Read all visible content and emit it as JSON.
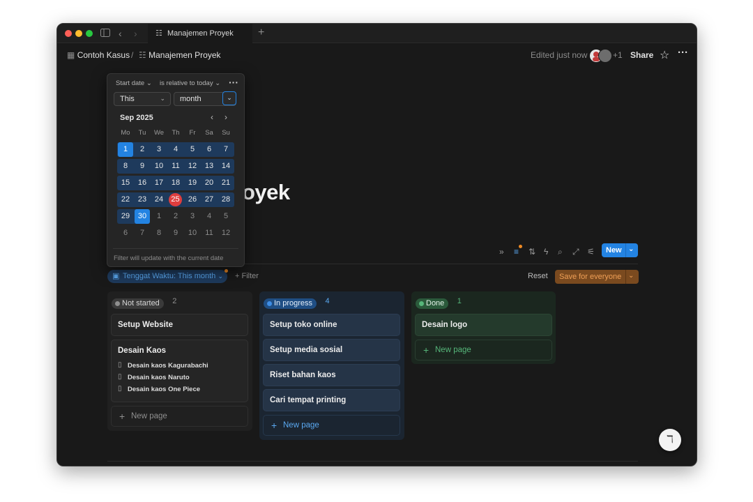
{
  "tab": {
    "title": "Manajemen Proyek",
    "icon": "checklist-icon"
  },
  "breadcrumb": {
    "workspace": "Contoh Kasus",
    "separator": "/",
    "page": "Manajemen Proyek"
  },
  "header": {
    "edited": "Edited just now",
    "extra_users": "+1",
    "share": "Share"
  },
  "page": {
    "title_visible": "oyek"
  },
  "toolbar": {
    "new_label": "New"
  },
  "filter": {
    "chip_label": "Tenggat Waktu: This month",
    "add_filter": "Filter",
    "reset": "Reset",
    "save": "Save for everyone"
  },
  "calendar": {
    "property": "Start date",
    "condition": "is relative to today",
    "relative": "This",
    "unit": "month",
    "month_label": "Sep 2025",
    "weekdays": [
      "Mo",
      "Tu",
      "We",
      "Th",
      "Fr",
      "Sa",
      "Su"
    ],
    "weeks": [
      [
        "1",
        "2",
        "3",
        "4",
        "5",
        "6",
        "7"
      ],
      [
        "8",
        "9",
        "10",
        "11",
        "12",
        "13",
        "14"
      ],
      [
        "15",
        "16",
        "17",
        "18",
        "19",
        "20",
        "21"
      ],
      [
        "22",
        "23",
        "24",
        "25",
        "26",
        "27",
        "28"
      ],
      [
        "29",
        "30",
        "1",
        "2",
        "3",
        "4",
        "5"
      ],
      [
        "6",
        "7",
        "8",
        "9",
        "10",
        "11",
        "12"
      ]
    ],
    "selected_day": "1",
    "today": "25",
    "range_end": "30",
    "footer": "Filter will update with the current date"
  },
  "board": {
    "columns": [
      {
        "status": "Not started",
        "count": "2",
        "cards": [
          {
            "title": "Setup Website"
          },
          {
            "title": "Desain Kaos",
            "subpages": [
              "Desain kaos Kagurabachi",
              "Desain kaos Naruto",
              "Desain kaos One Piece"
            ]
          }
        ],
        "new_page": "New page"
      },
      {
        "status": "In progress",
        "count": "4",
        "cards": [
          {
            "title": "Setup toko online"
          },
          {
            "title": "Setup media sosial"
          },
          {
            "title": "Riset bahan kaos"
          },
          {
            "title": "Cari tempat printing"
          }
        ],
        "new_page": "New page"
      },
      {
        "status": "Done",
        "count": "1",
        "cards": [
          {
            "title": "Desain logo"
          }
        ],
        "new_page": "New page"
      }
    ]
  },
  "colors": {
    "accent": "#2383e2",
    "today": "#e03e3e",
    "save": "#f0a057",
    "in_progress": "#5aa8f0",
    "done": "#56b67a"
  }
}
